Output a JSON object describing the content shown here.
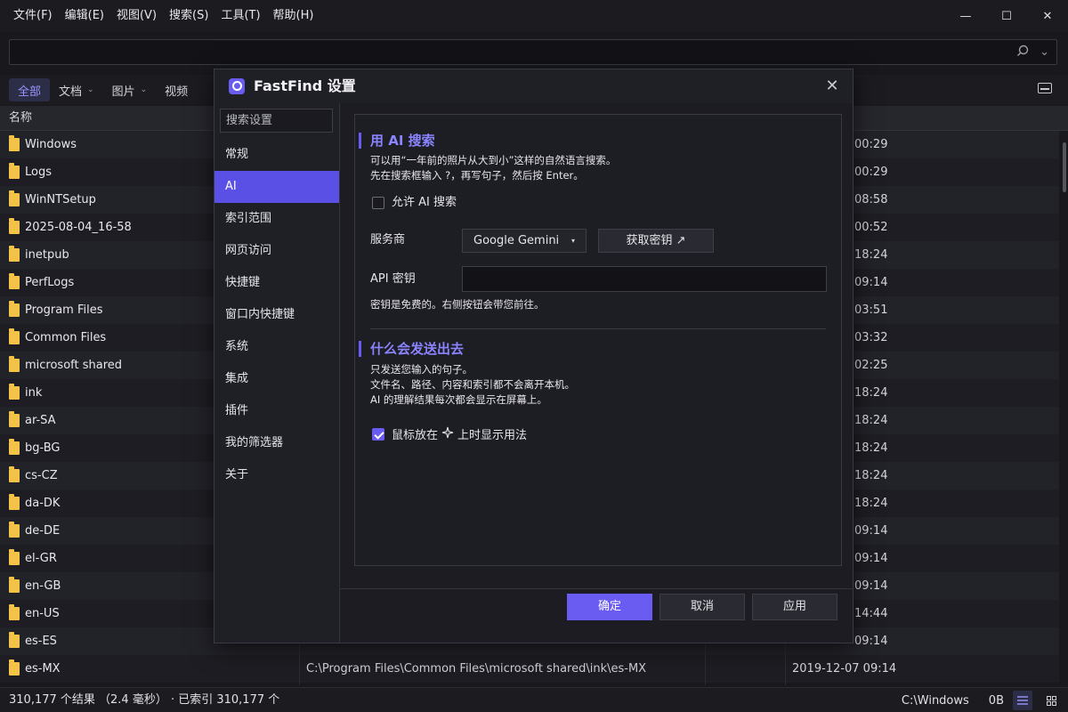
{
  "menubar": {
    "items": [
      "文件(F)",
      "编辑(E)",
      "视图(V)",
      "搜索(S)",
      "工具(T)",
      "帮助(H)"
    ],
    "minimize_glyph": "—",
    "maximize_glyph": "☐",
    "close_glyph": "✕"
  },
  "search": {
    "value": "",
    "placeholder": "",
    "search_icon": "search-icon",
    "dropdown_glyph": "⌄"
  },
  "filters": {
    "items": [
      {
        "label": "全部"
      },
      {
        "label": "文档"
      },
      {
        "label": "图片"
      },
      {
        "label": "视频"
      }
    ],
    "chevron": "⌄"
  },
  "table": {
    "header_name": "名称",
    "rows": [
      {
        "name": "Windows",
        "path": "",
        "time": "00:29"
      },
      {
        "name": "Logs",
        "path": "",
        "time": "00:29"
      },
      {
        "name": "WinNTSetup",
        "path": "",
        "time": "08:58"
      },
      {
        "name": "2025-08-04_16-58",
        "path": "",
        "time": "00:52"
      },
      {
        "name": "inetpub",
        "path": "",
        "time": "18:24"
      },
      {
        "name": "PerfLogs",
        "path": "",
        "time": "09:14"
      },
      {
        "name": "Program Files",
        "path": "",
        "time": "03:51"
      },
      {
        "name": "Common Files",
        "path": "",
        "time": "03:32"
      },
      {
        "name": "microsoft shared",
        "path": "",
        "time": "02:25"
      },
      {
        "name": "ink",
        "path": "",
        "time": "18:24"
      },
      {
        "name": "ar-SA",
        "path": "",
        "time": "18:24"
      },
      {
        "name": "bg-BG",
        "path": "",
        "time": "18:24"
      },
      {
        "name": "cs-CZ",
        "path": "",
        "time": "18:24"
      },
      {
        "name": "da-DK",
        "path": "",
        "time": "18:24"
      },
      {
        "name": "de-DE",
        "path": "",
        "time": "09:14"
      },
      {
        "name": "el-GR",
        "path": "",
        "time": "09:14"
      },
      {
        "name": "en-GB",
        "path": "",
        "time": "09:14"
      },
      {
        "name": "en-US",
        "path": "",
        "time": "14:44"
      },
      {
        "name": "es-ES",
        "path": "",
        "time": "09:14"
      },
      {
        "name": "es-MX",
        "path": "C:\\Program Files\\Common Files\\microsoft shared\\ink\\es-MX",
        "time": "2019-12-07 09:14"
      }
    ]
  },
  "status": {
    "left": "310,177 个结果 （2.4 毫秒） · 已索引 310,177 个",
    "path": "C:\\Windows",
    "size": "0B",
    "list_view_icon": "list-view-icon",
    "grid_view_icon": "grid-view-icon"
  },
  "dialog": {
    "title": "FastFind 设置",
    "close_glyph": "✕",
    "nav": {
      "search_placeholder": "搜索设置",
      "items": [
        "常规",
        "AI",
        "索引范围",
        "网页访问",
        "快捷键",
        "窗口内快捷键",
        "系统",
        "集成",
        "插件",
        "我的筛选器",
        "关于"
      ],
      "active_index": 1
    },
    "ai_section": {
      "heading": "用 AI 搜索",
      "desc_line1": "可以用“一年前的照片从大到小”这样的自然语言搜索。",
      "desc_line2": "先在搜索框输入 ?，再写句子，然后按 Enter。",
      "allow_label": "允许 AI 搜索",
      "allow_checked": false,
      "provider_label": "服务商",
      "provider_value": "Google Gemini",
      "provider_arrow": "▾",
      "get_key_label": "获取密钥 ↗",
      "api_key_label": "API 密钥",
      "api_key_value": "",
      "api_key_hint": "密钥是免费的。右侧按钮会带您前往。"
    },
    "send_section": {
      "heading": "什么会发送出去",
      "line1": "只发送您输入的句子。",
      "line2": "文件名、路径、内容和索引都不会离开本机。",
      "line3": "AI 的理解结果每次都会显示在屏幕上。",
      "hover_label_pre": "鼠标放在",
      "hover_icon": "sparkle-icon",
      "hover_label_post": "上时显示用法",
      "hover_checked": true
    },
    "footer": {
      "ok": "确定",
      "cancel": "取消",
      "apply": "应用"
    }
  },
  "colors": {
    "accent": "#6a5cf0",
    "folder": "#f3c348",
    "background": "#18181d"
  }
}
